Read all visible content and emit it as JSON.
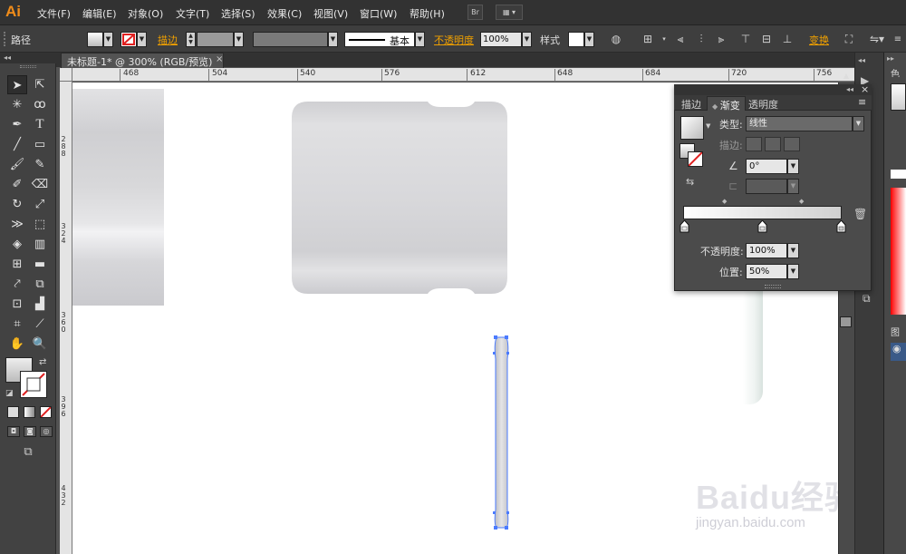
{
  "app": {
    "logo": "Ai"
  },
  "menu": {
    "items": [
      "文件(F)",
      "编辑(E)",
      "对象(O)",
      "文字(T)",
      "选择(S)",
      "效果(C)",
      "视图(V)",
      "窗口(W)",
      "帮助(H)"
    ],
    "bridge_button": "Br"
  },
  "controlbar": {
    "selection_label": "路径",
    "stroke_label": "描边",
    "brush_label": "基本",
    "opacity_label": "不透明度",
    "opacity_value": "100%",
    "style_label": "样式",
    "transform_label": "变换"
  },
  "document": {
    "tab_title": "未标题-1* @ 300% (RGB/预览)",
    "close": "×"
  },
  "ruler": {
    "top_labels": [
      "468",
      "504",
      "540",
      "576",
      "612",
      "648",
      "684",
      "720",
      "756"
    ],
    "left_labels": [
      "288",
      "324",
      "360",
      "396",
      "432"
    ]
  },
  "gradient_panel": {
    "tabs": [
      "描边",
      "渐变",
      "透明度"
    ],
    "active_tab": "渐变",
    "type_label": "类型",
    "type_value": "线性",
    "stroke_label": "描边",
    "angle_value": "0°",
    "opacity_label": "不透明度",
    "opacity_value": "100%",
    "location_label": "位置",
    "location_value": "50%",
    "expand_icon": "◂◂",
    "close_icon": "×",
    "menu_icon": "≡"
  },
  "watermark": {
    "brand": "Baidu经验",
    "url": "jingyan.baidu.com"
  },
  "colors": {
    "accent_orange": "#f0a000",
    "logo_orange": "#f08c1a",
    "selection_blue": "#4b7bff",
    "stroke_none_red": "#e02020"
  }
}
